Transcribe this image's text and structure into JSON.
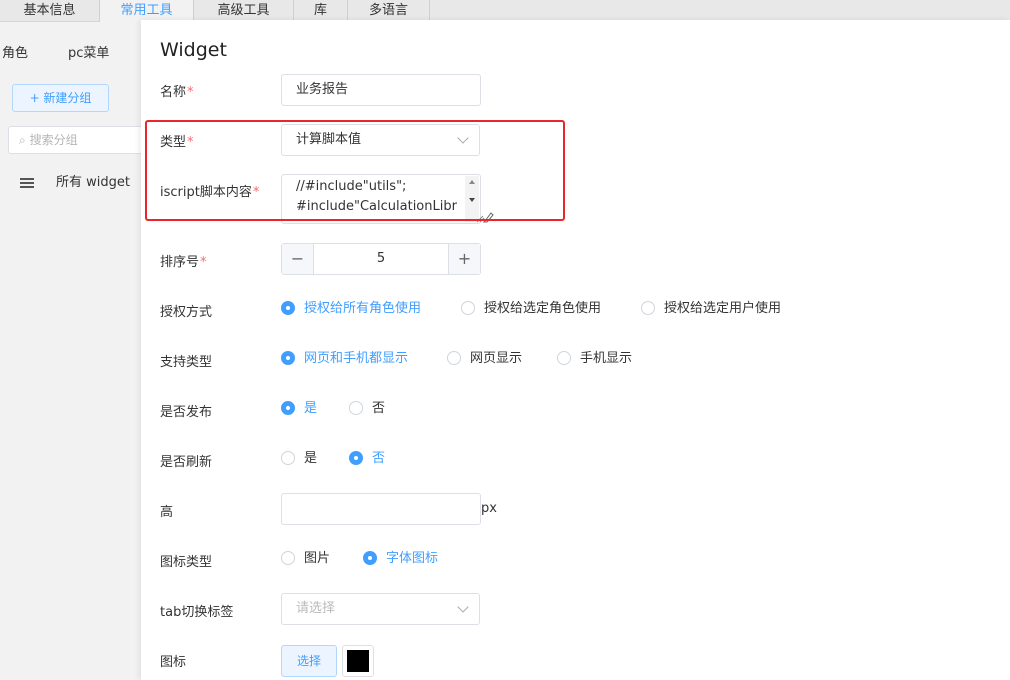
{
  "tabs": [
    {
      "label": "基本信息",
      "active": false
    },
    {
      "label": "常用工具",
      "active": true
    },
    {
      "label": "高级工具",
      "active": false
    },
    {
      "label": "库",
      "active": false
    },
    {
      "label": "多语言",
      "active": false
    }
  ],
  "subnav": {
    "role": "角色",
    "pc_menu": "pc菜单"
  },
  "sidebar": {
    "new_group_label": "+ 新建分组",
    "search_placeholder": "搜索分组",
    "all_widget_label": "所有 widget"
  },
  "dialog": {
    "title": "Widget",
    "fields": {
      "name": {
        "label": "名称",
        "required": "*",
        "value": "业务报告"
      },
      "type": {
        "label": "类型",
        "required": "*",
        "value": "计算脚本值"
      },
      "script": {
        "label": "iscript脚本内容",
        "required": "*",
        "lines": [
          "//#include\"utils\";",
          "#include\"CalculationLibr"
        ]
      },
      "order": {
        "label": "排序号",
        "required": "*",
        "value": "5",
        "minus": "−",
        "plus": "+"
      },
      "auth": {
        "label": "授权方式",
        "options": [
          "授权给所有角色使用",
          "授权给选定角色使用",
          "授权给选定用户使用"
        ],
        "selected": 0
      },
      "support": {
        "label": "支持类型",
        "options": [
          "网页和手机都显示",
          "网页显示",
          "手机显示"
        ],
        "selected": 0
      },
      "publish": {
        "label": "是否发布",
        "options": [
          "是",
          "否"
        ],
        "selected": 0
      },
      "refresh": {
        "label": "是否刷新",
        "options": [
          "是",
          "否"
        ],
        "selected": 1
      },
      "height": {
        "label": "高",
        "value": "",
        "suffix": "px"
      },
      "icon_type": {
        "label": "图标类型",
        "options": [
          "图片",
          "字体图标"
        ],
        "selected": 1
      },
      "tab_switch": {
        "label": "tab切换标签",
        "placeholder": "请选择"
      },
      "icon": {
        "label": "图标",
        "select_label": "选择"
      }
    }
  },
  "colors": {
    "accent": "#409eff",
    "required": "#f56c6c",
    "highlight": "#e8262c"
  }
}
